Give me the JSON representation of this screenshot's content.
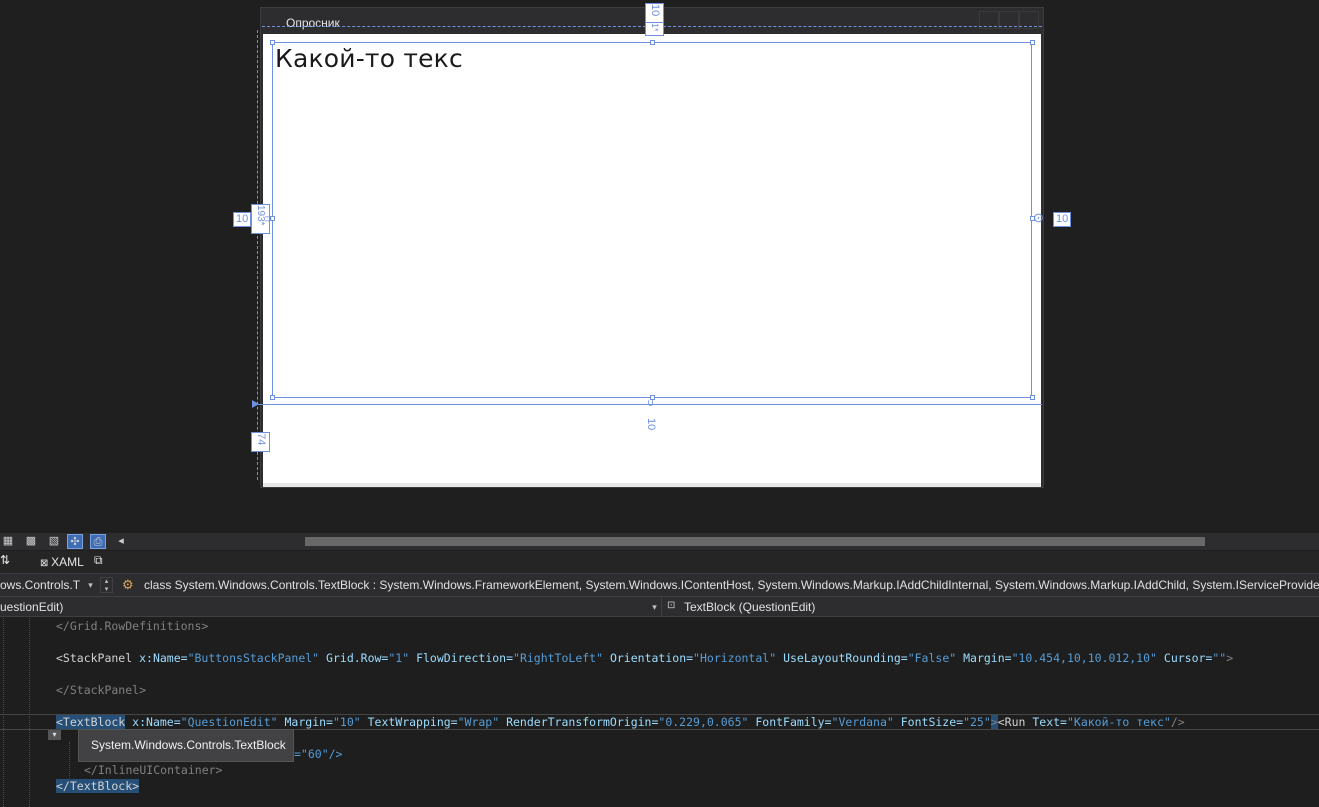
{
  "designer": {
    "window_title": "Опросник",
    "canvas_text": "Какой-то текс",
    "adorners": {
      "top_margin": "10",
      "top_row": "1*",
      "left_margin": "10",
      "left_row": "193*",
      "right_margin": "10",
      "bottom_margin": "10",
      "bottom_row": "74"
    }
  },
  "tabs": {
    "xaml_label": "XAML"
  },
  "navigation": {
    "type_selector": "ows.Controls.T",
    "class_signature": "class System.Windows.Controls.TextBlock : System.Windows.FrameworkElement, System.Windows.IContentHost, System.Windows.Markup.IAddChildInternal, System.Windows.Markup.IAddChild, System.IServiceProvider",
    "member_left": "uestionEdit)",
    "member_right": "TextBlock (QuestionEdit)"
  },
  "code": {
    "line1": "</Grid.RowDefinitions>",
    "line2": {
      "open": "<StackPanel",
      "a1": " x:Name=",
      "v1": "\"ButtonsStackPanel\"",
      "a2": " Grid.Row=",
      "v2": "\"1\"",
      "a3": " FlowDirection=",
      "v3": "\"RightToLeft\"",
      "a4": " Orientation=",
      "v4": "\"Horizontal\"",
      "a5": " UseLayoutRounding=",
      "v5": "\"False\"",
      "a6": " Margin=",
      "v6": "\"10.454,10,10.012,10\"",
      "a7": " Cursor=",
      "v7": "\"\"",
      "close": ">"
    },
    "line3": "</StackPanel>",
    "line4": {
      "open": "<TextBlock",
      "a1": " x:Name=",
      "v1": "\"QuestionEdit\"",
      "a2": " Margin=",
      "v2": "\"10\"",
      "a3": " TextWrapping=",
      "v3": "\"Wrap\"",
      "a4": " RenderTransformOrigin=",
      "v4": "\"0.229,0.065\"",
      "a5": " FontFamily=",
      "v5": "\"Verdana\"",
      "a6": " FontSize=",
      "v6": "\"25\"",
      "close": ">",
      "run_open": "<Run",
      "run_attr": " Text=",
      "run_val": "\"Какой-то текс\"",
      "run_close": "/>"
    },
    "line5_partial": "=\"60\"/>",
    "line6": "</InlineUIContainer>",
    "line7": "</TextBlock>"
  },
  "tooltip": "System.Windows.Controls.TextBlock"
}
